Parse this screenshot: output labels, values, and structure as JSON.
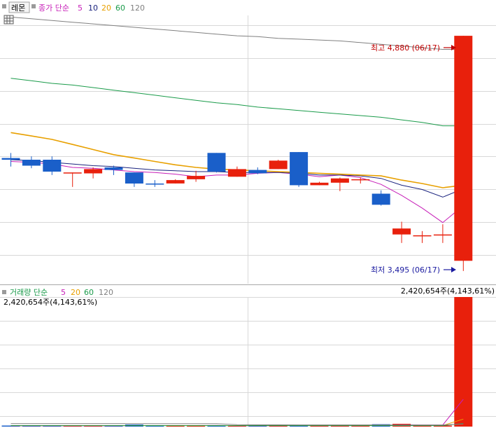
{
  "price_header": {
    "stock_name": "레몬",
    "ma_label": "종가 단순",
    "ma_periods": [
      "5",
      "10",
      "20",
      "60",
      "120"
    ]
  },
  "volume_header": {
    "title": "거래량 단순",
    "ma_periods": [
      "5",
      "20",
      "60",
      "120"
    ],
    "max_volume_label": "2,420,654주(4,143,61%)"
  },
  "annotations": {
    "high_label": "최고 4,880 (06/17)",
    "low_label": "최저 3,495 (06/17)"
  },
  "colors": {
    "up": "#e8200c",
    "down": "#1a5fc9",
    "ma5": "#c71fb8",
    "ma10": "#1a237e",
    "ma20": "#e8a000",
    "ma60": "#1a9b4a",
    "ma120": "#808080",
    "high_text": "#c00000",
    "low_text": "#1a1aa0"
  },
  "chart_data": [
    {
      "type": "candlestick",
      "panel": "price",
      "y_range_approx": [
        3420,
        5000
      ],
      "candles": [
        {
          "o": 4160,
          "h": 4190,
          "l": 4110,
          "c": 4150
        },
        {
          "o": 4150,
          "h": 4170,
          "l": 4100,
          "c": 4115
        },
        {
          "o": 4150,
          "h": 4170,
          "l": 4060,
          "c": 4080
        },
        {
          "o": 4075,
          "h": 4075,
          "l": 3990,
          "c": 4075
        },
        {
          "o": 4070,
          "h": 4105,
          "l": 4040,
          "c": 4095
        },
        {
          "o": 4105,
          "h": 4115,
          "l": 4060,
          "c": 4090
        },
        {
          "o": 4075,
          "h": 4075,
          "l": 3990,
          "c": 4010
        },
        {
          "o": 4010,
          "h": 4030,
          "l": 3990,
          "c": 4005
        },
        {
          "o": 4010,
          "h": 4035,
          "l": 4010,
          "c": 4030
        },
        {
          "o": 4035,
          "h": 4085,
          "l": 4020,
          "c": 4055
        },
        {
          "o": 4190,
          "h": 4190,
          "l": 4075,
          "c": 4080
        },
        {
          "o": 4050,
          "h": 4110,
          "l": 4050,
          "c": 4095
        },
        {
          "o": 4090,
          "h": 4105,
          "l": 4065,
          "c": 4070
        },
        {
          "o": 4095,
          "h": 4150,
          "l": 4095,
          "c": 4145
        },
        {
          "o": 4195,
          "h": 4195,
          "l": 3990,
          "c": 4000
        },
        {
          "o": 4000,
          "h": 4020,
          "l": 4000,
          "c": 4015
        },
        {
          "o": 4015,
          "h": 4045,
          "l": 3965,
          "c": 4040
        },
        {
          "o": 4035,
          "h": 4045,
          "l": 4010,
          "c": 4035
        },
        {
          "o": 3950,
          "h": 3970,
          "l": 3880,
          "c": 3885
        },
        {
          "o": 3710,
          "h": 3785,
          "l": 3660,
          "c": 3745
        },
        {
          "o": 3705,
          "h": 3730,
          "l": 3660,
          "c": 3705
        },
        {
          "o": 3710,
          "h": 3770,
          "l": 3660,
          "c": 3710
        },
        {
          "o": 3555,
          "h": 4880,
          "l": 3495,
          "c": 4880
        }
      ],
      "moving_averages": [
        {
          "period": 5,
          "values": [
            4140,
            4135,
            4125,
            4105,
            4100,
            4090,
            4080,
            4075,
            4065,
            4050,
            4060,
            4060,
            4070,
            4075,
            4065,
            4050,
            4060,
            4045,
            4005,
            3940,
            3865,
            3780,
            3880
          ]
        },
        {
          "period": 10,
          "values": [
            4150,
            4145,
            4135,
            4125,
            4115,
            4110,
            4100,
            4090,
            4085,
            4080,
            4080,
            4075,
            4075,
            4075,
            4070,
            4060,
            4060,
            4055,
            4040,
            4000,
            3975,
            3930,
            3980
          ]
        },
        {
          "period": 20,
          "values": [
            4310,
            4290,
            4270,
            4240,
            4210,
            4180,
            4160,
            4140,
            4120,
            4105,
            4095,
            4090,
            4085,
            4080,
            4075,
            4070,
            4065,
            4060,
            4055,
            4030,
            4010,
            3985,
            4000
          ]
        },
        {
          "period": 60,
          "values": [
            4630,
            4615,
            4600,
            4590,
            4575,
            4560,
            4545,
            4530,
            4515,
            4500,
            4485,
            4475,
            4460,
            4450,
            4440,
            4430,
            4420,
            4410,
            4400,
            4385,
            4370,
            4350,
            4350
          ]
        },
        {
          "period": 120,
          "values": [
            4990,
            4980,
            4970,
            4960,
            4950,
            4940,
            4930,
            4920,
            4910,
            4900,
            4890,
            4880,
            4875,
            4865,
            4860,
            4855,
            4850,
            4840,
            4830,
            4820,
            4810,
            4800,
            4800
          ]
        }
      ]
    },
    {
      "type": "bar",
      "panel": "volume",
      "y_range_approx": [
        0,
        2420654
      ],
      "values": [
        14000,
        13000,
        16000,
        12000,
        15000,
        14000,
        38000,
        16000,
        15000,
        18000,
        22000,
        16000,
        14000,
        15000,
        33000,
        12000,
        18000,
        15000,
        45000,
        52000,
        22000,
        18000,
        2420654
      ],
      "moving_averages": [
        {
          "period": 5,
          "values": [
            15000,
            15000,
            15000,
            14000,
            14000,
            14000,
            19000,
            19000,
            19000,
            20000,
            21000,
            17000,
            17000,
            17000,
            20000,
            18000,
            18000,
            18000,
            24000,
            33000,
            30000,
            30000,
            510000
          ]
        },
        {
          "period": 20,
          "values": [
            20000,
            20000,
            20000,
            20000,
            20000,
            20000,
            20000,
            20000,
            20000,
            20000,
            20000,
            20000,
            20000,
            20000,
            20000,
            20000,
            20000,
            20000,
            20000,
            21000,
            21000,
            21000,
            140000
          ]
        },
        {
          "period": 60,
          "values": [
            18000,
            18000,
            18000,
            18000,
            18000,
            18000,
            18000,
            18000,
            18000,
            18000,
            18000,
            18000,
            18000,
            18000,
            18000,
            18000,
            18000,
            18000,
            18000,
            18000,
            18000,
            18000,
            58000
          ]
        },
        {
          "period": 120,
          "values": [
            55000,
            55000,
            55000,
            55000,
            55000,
            55000,
            55000,
            54000,
            54000,
            54000,
            54000,
            35000,
            33000,
            33000,
            32000,
            32000,
            32000,
            31000,
            31000,
            30000,
            30000,
            30000,
            50000
          ]
        }
      ]
    }
  ]
}
